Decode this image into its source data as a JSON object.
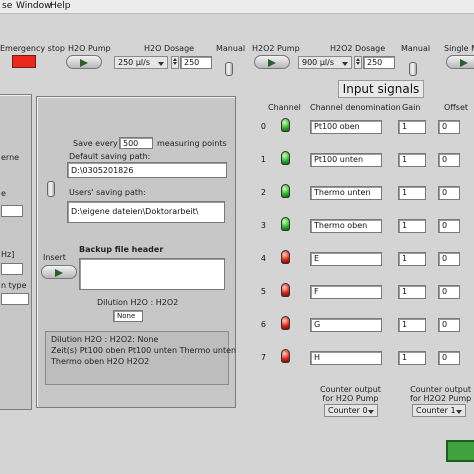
{
  "menu": [
    "se",
    "Window",
    "Help"
  ],
  "top": {
    "emergency_label": "Emergency stop",
    "h2o_pump_label": "H2O Pump",
    "h2o_dosage_label": "H2O Dosage",
    "h2o_dosage_select": "250 µl/s",
    "h2o_dosage_value": "250",
    "manual1": "Manual",
    "h2o2_pump_label": "H2O2 Pump",
    "h2o2_dosage_label": "H2O2 Dosage",
    "h2o2_dosage_select": "900 µl/s",
    "h2o2_dosage_value": "250",
    "manual2": "Manual",
    "single_label": "Single M"
  },
  "left": {
    "items": [
      "erne",
      "e",
      "Hz]",
      "n type"
    ]
  },
  "save": {
    "save_every": "Save every",
    "save_value": "500",
    "measuring_points": "measuring points",
    "default_path_label": "Default saving path:",
    "default_path_value": "D:\\0305201826",
    "users_path_label": "Users' saving path:",
    "users_path_value": "D:\\eigene dateien\\Doktorarbeit\\",
    "insert_label": "Insert",
    "backup_header_label": "Backup file header",
    "dilution_label": "Dilution H2O : H2O2",
    "dilution_value": "None",
    "info_line1": "Dilution H2O : H2O2:  None",
    "info_line2": "Zeit(s)  Pt100 oben Pt100 unten Thermo unten",
    "info_line3": "Thermo oben  H2O  H2O2"
  },
  "input": {
    "title": "Input signals",
    "col_channel": "Channel",
    "col_denom": "Channel denomination",
    "col_gain": "Gain",
    "col_offset": "Offset",
    "channels": [
      {
        "num": "0",
        "state": "on",
        "name": "Pt100 oben",
        "gain": "1",
        "offset": "0"
      },
      {
        "num": "1",
        "state": "on",
        "name": "Pt100 unten",
        "gain": "1",
        "offset": "0"
      },
      {
        "num": "2",
        "state": "on",
        "name": "Thermo unten",
        "gain": "1",
        "offset": "0"
      },
      {
        "num": "3",
        "state": "on",
        "name": "Thermo oben",
        "gain": "1",
        "offset": "0"
      },
      {
        "num": "4",
        "state": "off",
        "name": "E",
        "gain": "1",
        "offset": "0"
      },
      {
        "num": "5",
        "state": "off",
        "name": "F",
        "gain": "1",
        "offset": "0"
      },
      {
        "num": "6",
        "state": "off",
        "name": "G",
        "gain": "1",
        "offset": "0"
      },
      {
        "num": "7",
        "state": "off",
        "name": "H",
        "gain": "1",
        "offset": "0"
      }
    ]
  },
  "counters": {
    "h2o_label": "Counter output\nfor H2O Pump",
    "h2o_value": "Counter 0",
    "h2o2_label": "Counter output\nfor H2O2 Pump",
    "h2o2_value": "Counter 1"
  },
  "colors": {
    "emergency": "#e8291c",
    "led_on": "#2fb62f",
    "led_off": "#e0261b",
    "accent_green": "#3fa23f"
  }
}
